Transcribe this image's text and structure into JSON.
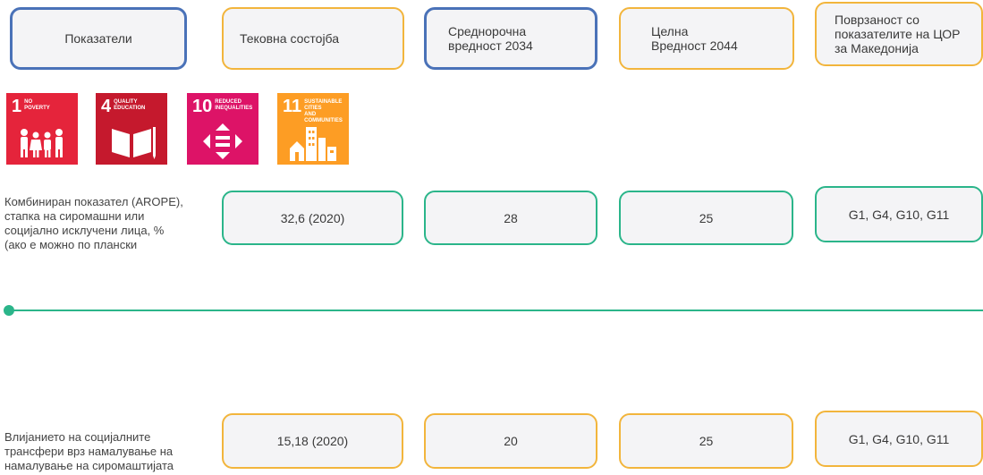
{
  "headers": {
    "indicators": "Показатели",
    "current": "Тековна состојба",
    "midterm": "Среднорочна\nвредност 2034",
    "target": "Целна\nВредност 2044",
    "relevance": "Поврзаност со\nпоказателите на ЦОР\nза Македонија"
  },
  "sdg_icons": [
    {
      "number": "1",
      "caption": "NO\nPOVERTY",
      "color": "#e5243b",
      "icon": "family-icon"
    },
    {
      "number": "4",
      "caption": "QUALITY\nEDUCATION",
      "color": "#c5192d",
      "icon": "book-icon"
    },
    {
      "number": "10",
      "caption": "REDUCED\nINEQUALITIES",
      "color": "#dd1367",
      "icon": "equality-arrows-icon"
    },
    {
      "number": "11",
      "caption": "SUSTAINABLE CITIES\nAND COMMUNITIES",
      "color": "#fd9d24",
      "icon": "city-buildings-icon"
    }
  ],
  "rows": [
    {
      "description": "Комбиниран показател (AROPE),\nстапка на сиромашни или\nсоцијално исклучени лица, %\n(ако е можно по плански",
      "current": "32,6 (2020)",
      "midterm": "28",
      "target": "25",
      "relevance": "G1, G4, G10, G11"
    },
    {
      "description": "Влијанието на социјалните\nтрансфери врз намалување на\nнамалување на сиромаштијата",
      "current": "15,18 (2020)",
      "midterm": "20",
      "target": "25",
      "relevance": "G1, G4, G10, G11"
    }
  ]
}
